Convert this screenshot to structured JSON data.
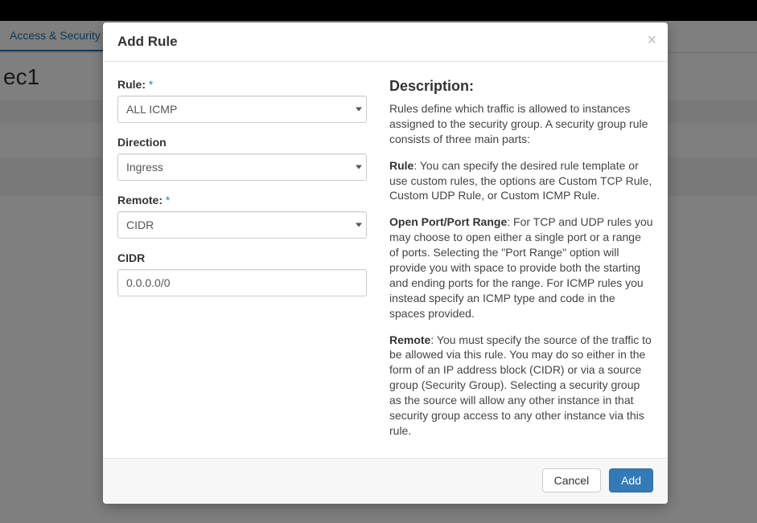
{
  "background": {
    "nav_tab": "Access & Security",
    "page_title": "ec1"
  },
  "modal": {
    "title": "Add Rule",
    "close_glyph": "×",
    "form": {
      "rule": {
        "label": "Rule:",
        "required_mark": "*",
        "value": "ALL ICMP"
      },
      "direction": {
        "label": "Direction",
        "value": "Ingress"
      },
      "remote": {
        "label": "Remote:",
        "required_mark": "*",
        "value": "CIDR"
      },
      "cidr": {
        "label": "CIDR",
        "value": "0.0.0.0/0"
      }
    },
    "description": {
      "heading": "Description:",
      "intro": "Rules define which traffic is allowed to instances assigned to the security group. A security group rule consists of three main parts:",
      "rule_label": "Rule",
      "rule_text": ": You can specify the desired rule template or use custom rules, the options are Custom TCP Rule, Custom UDP Rule, or Custom ICMP Rule.",
      "port_label": "Open Port/Port Range",
      "port_text": ": For TCP and UDP rules you may choose to open either a single port or a range of ports. Selecting the \"Port Range\" option will provide you with space to provide both the starting and ending ports for the range. For ICMP rules you instead specify an ICMP type and code in the spaces provided.",
      "remote_label": "Remote",
      "remote_text": ": You must specify the source of the traffic to be allowed via this rule. You may do so either in the form of an IP address block (CIDR) or via a source group (Security Group). Selecting a security group as the source will allow any other instance in that security group access to any other instance via this rule."
    },
    "footer": {
      "cancel": "Cancel",
      "add": "Add"
    }
  }
}
